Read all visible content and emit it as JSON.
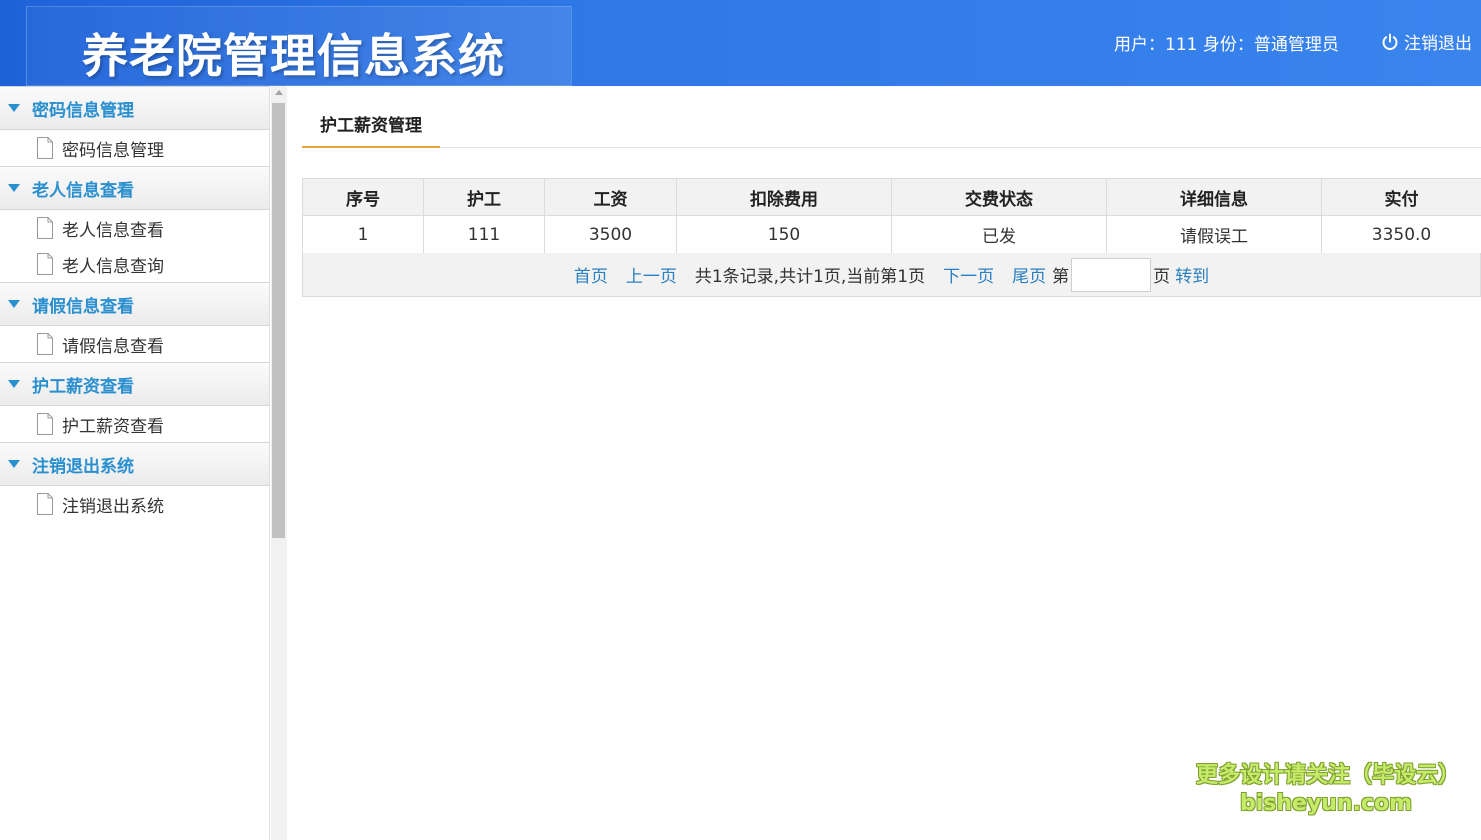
{
  "header": {
    "app_title": "养老院管理信息系统",
    "user_info": "用户：111 身份：普通管理员",
    "logout_label": "注销退出"
  },
  "sidebar": {
    "groups": [
      {
        "title": "密码信息管理",
        "items": [
          "密码信息管理"
        ]
      },
      {
        "title": "老人信息查看",
        "items": [
          "老人信息查看",
          "老人信息查询"
        ]
      },
      {
        "title": "请假信息查看",
        "items": [
          "请假信息查看"
        ]
      },
      {
        "title": "护工薪资查看",
        "items": [
          "护工薪资查看"
        ]
      },
      {
        "title": "注销退出系统",
        "items": [
          "注销退出系统"
        ]
      }
    ]
  },
  "main": {
    "tab_label": "护工薪资管理",
    "table": {
      "headers": [
        "序号",
        "护工",
        "工资",
        "扣除费用",
        "交费状态",
        "详细信息",
        "实付"
      ],
      "rows": [
        [
          "1",
          "111",
          "3500",
          "150",
          "已发",
          "请假误工",
          "3350.0"
        ]
      ]
    },
    "pager": {
      "first": "首页",
      "prev": "上一页",
      "summary": "共1条记录,共计1页,当前第1页",
      "next": "下一页",
      "last": "尾页",
      "page_prefix": "第",
      "page_suffix": "页",
      "goto": "转到",
      "page_input_value": ""
    }
  },
  "watermark": {
    "line1": "更多设计请关注（毕设云）",
    "line2": "bisheyun.com"
  },
  "colors": {
    "header_blue": "#2f78e6",
    "accent_blue": "#2a8fcf",
    "tab_underline": "#e8a33a",
    "link_blue": "#2a7fc0"
  }
}
